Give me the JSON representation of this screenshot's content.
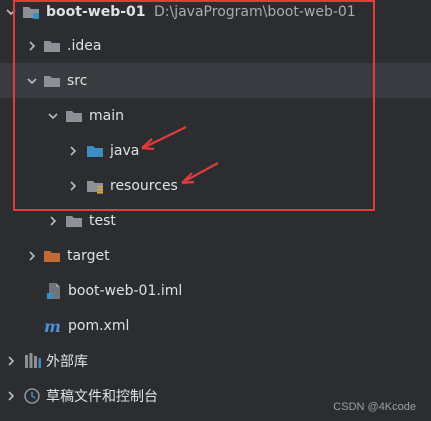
{
  "tree": {
    "root": {
      "label": "boot-web-01",
      "path": "D:\\javaProgram\\boot-web-01"
    },
    "idea": {
      "label": ".idea"
    },
    "src": {
      "label": "src"
    },
    "main": {
      "label": "main"
    },
    "java": {
      "label": "java"
    },
    "resources": {
      "label": "resources"
    },
    "test": {
      "label": "test"
    },
    "target": {
      "label": "target"
    },
    "iml": {
      "label": "boot-web-01.iml"
    },
    "pom": {
      "label": "pom.xml"
    },
    "external_libraries": {
      "label": "外部库"
    },
    "scratches": {
      "label": "草稿文件和控制台"
    }
  },
  "watermark": "CSDN @4Kcode",
  "colors": {
    "background": "#2b2d30",
    "selection": "#393b40",
    "annotation_red": "#e03c3c",
    "folder_gray": "#8c9197",
    "source_folder_blue": "#3d8cc4",
    "excluded_folder_orange": "#c26a35",
    "maven_blue": "#4d8fd8"
  }
}
